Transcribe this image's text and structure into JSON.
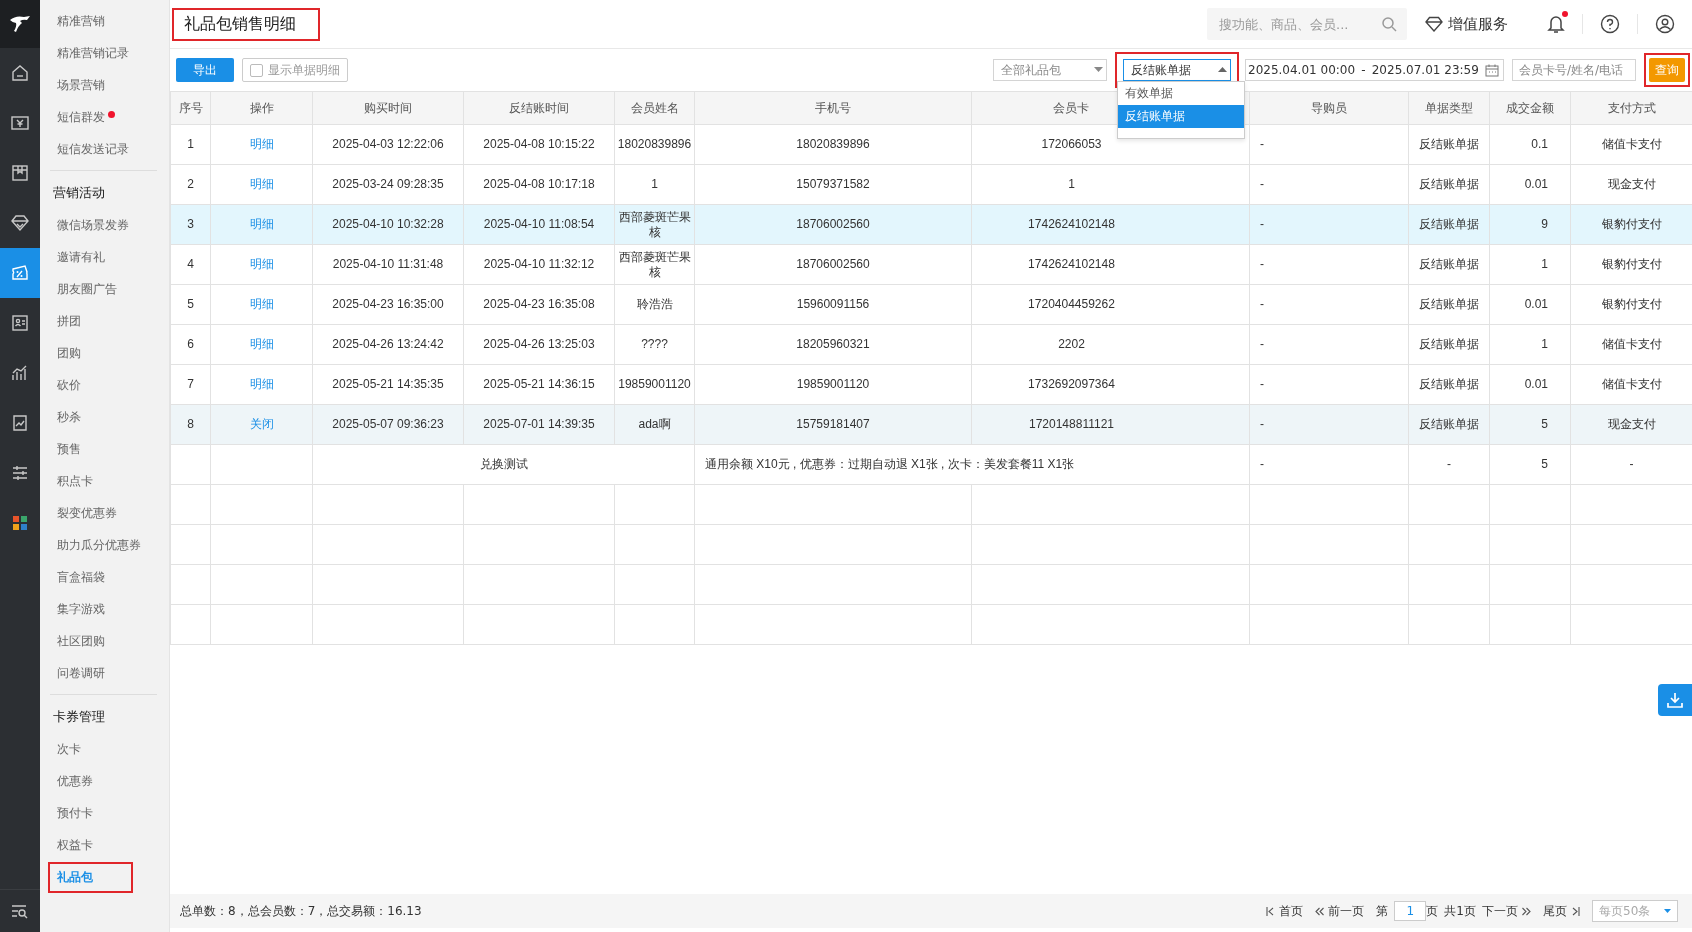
{
  "rail": {
    "items": [
      {
        "selected": false
      },
      {
        "selected": false
      },
      {
        "selected": false
      },
      {
        "selected": false
      },
      {
        "selected": true
      },
      {
        "selected": false
      },
      {
        "selected": false
      },
      {
        "selected": false
      },
      {
        "selected": false
      },
      {
        "selected": false
      }
    ]
  },
  "sidebar": {
    "groups": [
      {
        "items": [
          {
            "label": "精准营销",
            "selected": false,
            "dot": false,
            "boxed": false
          },
          {
            "label": "精准营销记录",
            "selected": false,
            "dot": false,
            "boxed": false
          },
          {
            "label": "场景营销",
            "selected": false,
            "dot": false,
            "boxed": false
          },
          {
            "label": "短信群发",
            "selected": false,
            "dot": true,
            "boxed": false
          },
          {
            "label": "短信发送记录",
            "selected": false,
            "dot": false,
            "boxed": false
          }
        ]
      },
      {
        "heading": "营销活动",
        "items": [
          {
            "label": "微信场景发券",
            "selected": false,
            "dot": false,
            "boxed": false
          },
          {
            "label": "邀请有礼",
            "selected": false,
            "dot": false,
            "boxed": false
          },
          {
            "label": "朋友圈广告",
            "selected": false,
            "dot": false,
            "boxed": false
          },
          {
            "label": "拼团",
            "selected": false,
            "dot": false,
            "boxed": false
          },
          {
            "label": "团购",
            "selected": false,
            "dot": false,
            "boxed": false
          },
          {
            "label": "砍价",
            "selected": false,
            "dot": false,
            "boxed": false
          },
          {
            "label": "秒杀",
            "selected": false,
            "dot": false,
            "boxed": false
          },
          {
            "label": "预售",
            "selected": false,
            "dot": false,
            "boxed": false
          },
          {
            "label": "积点卡",
            "selected": false,
            "dot": false,
            "boxed": false
          },
          {
            "label": "裂变优惠券",
            "selected": false,
            "dot": false,
            "boxed": false
          },
          {
            "label": "助力瓜分优惠券",
            "selected": false,
            "dot": false,
            "boxed": false
          },
          {
            "label": "盲盒福袋",
            "selected": false,
            "dot": false,
            "boxed": false
          },
          {
            "label": "集字游戏",
            "selected": false,
            "dot": false,
            "boxed": false
          },
          {
            "label": "社区团购",
            "selected": false,
            "dot": false,
            "boxed": false
          },
          {
            "label": "问卷调研",
            "selected": false,
            "dot": false,
            "boxed": false
          }
        ]
      },
      {
        "heading": "卡券管理",
        "items": [
          {
            "label": "次卡",
            "selected": false,
            "dot": false,
            "boxed": false
          },
          {
            "label": "优惠券",
            "selected": false,
            "dot": false,
            "boxed": false
          },
          {
            "label": "预付卡",
            "selected": false,
            "dot": false,
            "boxed": false
          },
          {
            "label": "权益卡",
            "selected": false,
            "dot": false,
            "boxed": false
          },
          {
            "label": "礼品包",
            "selected": true,
            "dot": false,
            "boxed": true
          }
        ]
      }
    ]
  },
  "header": {
    "title": "礼品包销售明细",
    "title_boxed": true,
    "search": {
      "placeholder": "搜功能、商品、会员..."
    },
    "value_added": "增值服务",
    "notification_dot": true
  },
  "toolbar": {
    "export": "导出",
    "show_details": {
      "label": "显示单据明细",
      "checked": false
    },
    "package_select": {
      "value": "全部礼品包"
    },
    "bill_select": {
      "value": "反结账单据",
      "open": true,
      "boxed": true,
      "options": [
        {
          "label": "有效单据",
          "selected": false
        },
        {
          "label": "反结账单据",
          "selected": true
        }
      ]
    },
    "date_from": "2025.04.01 00:00",
    "date_sep": "-",
    "date_to": "2025.07.01 23:59",
    "member_search": {
      "placeholder": "会员卡号/姓名/电话"
    },
    "query": {
      "label": "查询",
      "boxed": true
    }
  },
  "table": {
    "columns": [
      "序号",
      "操作",
      "购买时间",
      "反结账时间",
      "会员姓名",
      "手机号",
      "会员卡",
      "导购员",
      "单据类型",
      "成交金额",
      "支付方式"
    ],
    "rows": [
      {
        "no": "1",
        "action": "明细",
        "buy_time": "2025-04-03 12:22:06",
        "reverse_time": "2025-04-08 10:15:22",
        "name": "18020839896",
        "phone": "18020839896",
        "card": "172066053",
        "guide": "-",
        "type": "反结账单据",
        "amount": "0.1",
        "payment": "储值卡支付",
        "hovered": false,
        "selected": false
      },
      {
        "no": "2",
        "action": "明细",
        "buy_time": "2025-03-24 09:28:35",
        "reverse_time": "2025-04-08 10:17:18",
        "name": "1",
        "phone": "15079371582",
        "card": "1",
        "guide": "-",
        "type": "反结账单据",
        "amount": "0.01",
        "payment": "现金支付",
        "hovered": false,
        "selected": false
      },
      {
        "no": "3",
        "action": "明细",
        "buy_time": "2025-04-10 10:32:28",
        "reverse_time": "2025-04-10 11:08:54",
        "name": "西部菱斑芒果核",
        "phone": "18706002560",
        "card": "1742624102148",
        "guide": "-",
        "type": "反结账单据",
        "amount": "9",
        "payment": "银豹付支付",
        "hovered": true,
        "selected": false
      },
      {
        "no": "4",
        "action": "明细",
        "buy_time": "2025-04-10 11:31:48",
        "reverse_time": "2025-04-10 11:32:12",
        "name": "西部菱斑芒果核",
        "phone": "18706002560",
        "card": "1742624102148",
        "guide": "-",
        "type": "反结账单据",
        "amount": "1",
        "payment": "银豹付支付",
        "hovered": false,
        "selected": false
      },
      {
        "no": "5",
        "action": "明细",
        "buy_time": "2025-04-23 16:35:00",
        "reverse_time": "2025-04-23 16:35:08",
        "name": "聆浩浩",
        "phone": "15960091156",
        "card": "1720404459262",
        "guide": "-",
        "type": "反结账单据",
        "amount": "0.01",
        "payment": "银豹付支付",
        "hovered": false,
        "selected": false
      },
      {
        "no": "6",
        "action": "明细",
        "buy_time": "2025-04-26 13:24:42",
        "reverse_time": "2025-04-26 13:25:03",
        "name": "????",
        "phone": "18205960321",
        "card": "2202",
        "guide": "-",
        "type": "反结账单据",
        "amount": "1",
        "payment": "储值卡支付",
        "hovered": false,
        "selected": false
      },
      {
        "no": "7",
        "action": "明细",
        "buy_time": "2025-05-21 14:35:35",
        "reverse_time": "2025-05-21 14:36:15",
        "name": "19859001120",
        "phone": "19859001120",
        "card": "1732692097364",
        "guide": "-",
        "type": "反结账单据",
        "amount": "0.01",
        "payment": "储值卡支付",
        "hovered": false,
        "selected": false
      },
      {
        "no": "8",
        "action": "关闭",
        "buy_time": "2025-05-07 09:36:23",
        "reverse_time": "2025-07-01 14:39:35",
        "name": "ada啊",
        "phone": "15759181407",
        "card": "1720148811121",
        "guide": "-",
        "type": "反结账单据",
        "amount": "5",
        "payment": "现金支付",
        "hovered": false,
        "selected": true
      }
    ],
    "detail_row": {
      "label": "兑换测试",
      "content": "通用余额 X10元 , 优惠券：过期自动退 X1张 , 次卡：美发套餐11 X1张",
      "guide": "-",
      "type": "-",
      "amount": "5",
      "payment": "-"
    }
  },
  "footer": {
    "summary": "总单数：8，总会员数：7，总交易额：16.13",
    "pager": {
      "first": "首页",
      "prev": "前一页",
      "page_prefix": "第",
      "page": "1",
      "page_suffix": "页",
      "total": "共1页",
      "next": "下一页",
      "last": "尾页",
      "page_size": "每页50条"
    }
  }
}
